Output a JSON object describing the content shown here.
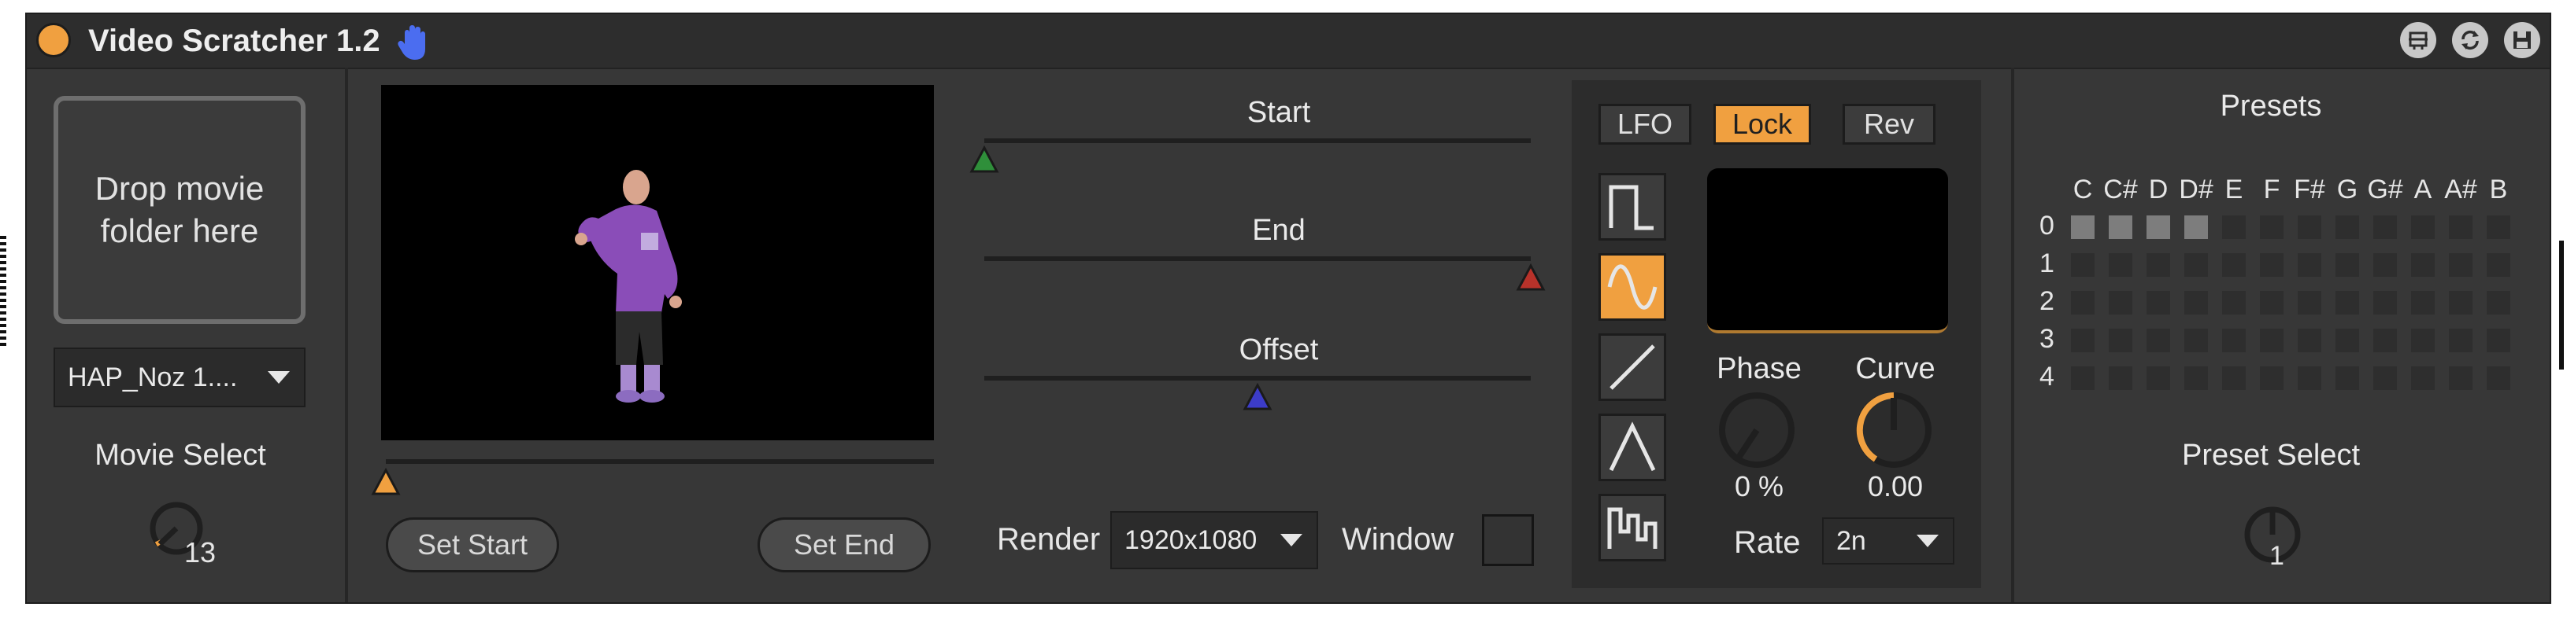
{
  "device": {
    "title": "Video Scratcher 1.2",
    "title_icon": "hand-icon",
    "header_icons": [
      "display-icon",
      "refresh-icon",
      "save-icon"
    ]
  },
  "movie": {
    "drop_text_line1": "Drop movie",
    "drop_text_line2": "folder here",
    "selected_folder": "HAP_Noz 1....",
    "select_label": "Movie Select",
    "select_value": "13"
  },
  "preview": {
    "set_start_label": "Set Start",
    "set_end_label": "Set End",
    "position": 0.0
  },
  "ranges": {
    "start_label": "Start",
    "end_label": "End",
    "offset_label": "Offset",
    "start_value": 0.0,
    "end_value": 1.0,
    "offset_value": 0.5
  },
  "render": {
    "label": "Render",
    "resolution": "1920x1080",
    "window_label": "Window",
    "window_checked": false
  },
  "lfo": {
    "lfo_label": "LFO",
    "lock_label": "Lock",
    "rev_label": "Rev",
    "lock_on": true,
    "waveforms": [
      "square",
      "sine",
      "ramp",
      "triangle",
      "random"
    ],
    "selected_waveform": "sine",
    "phase_label": "Phase",
    "phase_value": "0 %",
    "curve_label": "Curve",
    "curve_value": "0.00",
    "rate_label": "Rate",
    "rate_value": "2n"
  },
  "presets": {
    "title": "Presets",
    "notes": [
      "C",
      "C#",
      "D",
      "D#",
      "E",
      "F",
      "F#",
      "G",
      "G#",
      "A",
      "A#",
      "B"
    ],
    "rows": [
      "0",
      "1",
      "2",
      "3",
      "4"
    ],
    "filled": [
      [
        0,
        0
      ],
      [
        0,
        1
      ],
      [
        0,
        2
      ],
      [
        0,
        3
      ]
    ],
    "select_label": "Preset Select",
    "select_value": "1"
  },
  "colors": {
    "accent": "#f0a040",
    "start_marker": "#2f8f3a",
    "end_marker": "#b8322a",
    "offset_marker": "#3c3cc8",
    "hand_icon": "#4b6df0"
  }
}
